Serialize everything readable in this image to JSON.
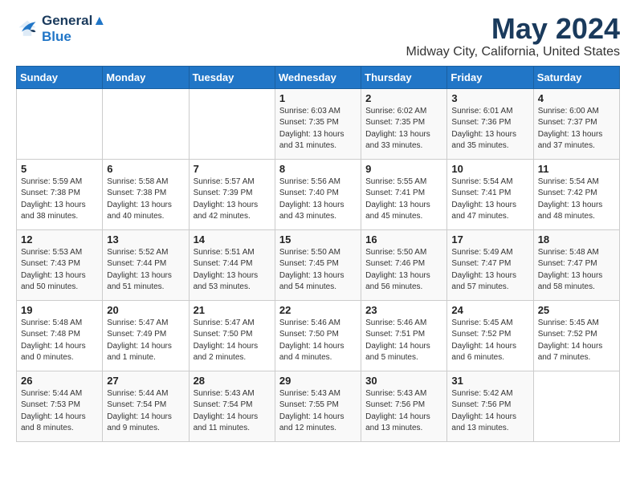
{
  "logo": {
    "line1": "General",
    "line2": "Blue"
  },
  "title": "May 2024",
  "location": "Midway City, California, United States",
  "weekdays": [
    "Sunday",
    "Monday",
    "Tuesday",
    "Wednesday",
    "Thursday",
    "Friday",
    "Saturday"
  ],
  "weeks": [
    [
      {
        "day": "",
        "sunrise": "",
        "sunset": "",
        "daylight": ""
      },
      {
        "day": "",
        "sunrise": "",
        "sunset": "",
        "daylight": ""
      },
      {
        "day": "",
        "sunrise": "",
        "sunset": "",
        "daylight": ""
      },
      {
        "day": "1",
        "sunrise": "Sunrise: 6:03 AM",
        "sunset": "Sunset: 7:35 PM",
        "daylight": "Daylight: 13 hours and 31 minutes."
      },
      {
        "day": "2",
        "sunrise": "Sunrise: 6:02 AM",
        "sunset": "Sunset: 7:35 PM",
        "daylight": "Daylight: 13 hours and 33 minutes."
      },
      {
        "day": "3",
        "sunrise": "Sunrise: 6:01 AM",
        "sunset": "Sunset: 7:36 PM",
        "daylight": "Daylight: 13 hours and 35 minutes."
      },
      {
        "day": "4",
        "sunrise": "Sunrise: 6:00 AM",
        "sunset": "Sunset: 7:37 PM",
        "daylight": "Daylight: 13 hours and 37 minutes."
      }
    ],
    [
      {
        "day": "5",
        "sunrise": "Sunrise: 5:59 AM",
        "sunset": "Sunset: 7:38 PM",
        "daylight": "Daylight: 13 hours and 38 minutes."
      },
      {
        "day": "6",
        "sunrise": "Sunrise: 5:58 AM",
        "sunset": "Sunset: 7:38 PM",
        "daylight": "Daylight: 13 hours and 40 minutes."
      },
      {
        "day": "7",
        "sunrise": "Sunrise: 5:57 AM",
        "sunset": "Sunset: 7:39 PM",
        "daylight": "Daylight: 13 hours and 42 minutes."
      },
      {
        "day": "8",
        "sunrise": "Sunrise: 5:56 AM",
        "sunset": "Sunset: 7:40 PM",
        "daylight": "Daylight: 13 hours and 43 minutes."
      },
      {
        "day": "9",
        "sunrise": "Sunrise: 5:55 AM",
        "sunset": "Sunset: 7:41 PM",
        "daylight": "Daylight: 13 hours and 45 minutes."
      },
      {
        "day": "10",
        "sunrise": "Sunrise: 5:54 AM",
        "sunset": "Sunset: 7:41 PM",
        "daylight": "Daylight: 13 hours and 47 minutes."
      },
      {
        "day": "11",
        "sunrise": "Sunrise: 5:54 AM",
        "sunset": "Sunset: 7:42 PM",
        "daylight": "Daylight: 13 hours and 48 minutes."
      }
    ],
    [
      {
        "day": "12",
        "sunrise": "Sunrise: 5:53 AM",
        "sunset": "Sunset: 7:43 PM",
        "daylight": "Daylight: 13 hours and 50 minutes."
      },
      {
        "day": "13",
        "sunrise": "Sunrise: 5:52 AM",
        "sunset": "Sunset: 7:44 PM",
        "daylight": "Daylight: 13 hours and 51 minutes."
      },
      {
        "day": "14",
        "sunrise": "Sunrise: 5:51 AM",
        "sunset": "Sunset: 7:44 PM",
        "daylight": "Daylight: 13 hours and 53 minutes."
      },
      {
        "day": "15",
        "sunrise": "Sunrise: 5:50 AM",
        "sunset": "Sunset: 7:45 PM",
        "daylight": "Daylight: 13 hours and 54 minutes."
      },
      {
        "day": "16",
        "sunrise": "Sunrise: 5:50 AM",
        "sunset": "Sunset: 7:46 PM",
        "daylight": "Daylight: 13 hours and 56 minutes."
      },
      {
        "day": "17",
        "sunrise": "Sunrise: 5:49 AM",
        "sunset": "Sunset: 7:47 PM",
        "daylight": "Daylight: 13 hours and 57 minutes."
      },
      {
        "day": "18",
        "sunrise": "Sunrise: 5:48 AM",
        "sunset": "Sunset: 7:47 PM",
        "daylight": "Daylight: 13 hours and 58 minutes."
      }
    ],
    [
      {
        "day": "19",
        "sunrise": "Sunrise: 5:48 AM",
        "sunset": "Sunset: 7:48 PM",
        "daylight": "Daylight: 14 hours and 0 minutes."
      },
      {
        "day": "20",
        "sunrise": "Sunrise: 5:47 AM",
        "sunset": "Sunset: 7:49 PM",
        "daylight": "Daylight: 14 hours and 1 minute."
      },
      {
        "day": "21",
        "sunrise": "Sunrise: 5:47 AM",
        "sunset": "Sunset: 7:50 PM",
        "daylight": "Daylight: 14 hours and 2 minutes."
      },
      {
        "day": "22",
        "sunrise": "Sunrise: 5:46 AM",
        "sunset": "Sunset: 7:50 PM",
        "daylight": "Daylight: 14 hours and 4 minutes."
      },
      {
        "day": "23",
        "sunrise": "Sunrise: 5:46 AM",
        "sunset": "Sunset: 7:51 PM",
        "daylight": "Daylight: 14 hours and 5 minutes."
      },
      {
        "day": "24",
        "sunrise": "Sunrise: 5:45 AM",
        "sunset": "Sunset: 7:52 PM",
        "daylight": "Daylight: 14 hours and 6 minutes."
      },
      {
        "day": "25",
        "sunrise": "Sunrise: 5:45 AM",
        "sunset": "Sunset: 7:52 PM",
        "daylight": "Daylight: 14 hours and 7 minutes."
      }
    ],
    [
      {
        "day": "26",
        "sunrise": "Sunrise: 5:44 AM",
        "sunset": "Sunset: 7:53 PM",
        "daylight": "Daylight: 14 hours and 8 minutes."
      },
      {
        "day": "27",
        "sunrise": "Sunrise: 5:44 AM",
        "sunset": "Sunset: 7:54 PM",
        "daylight": "Daylight: 14 hours and 9 minutes."
      },
      {
        "day": "28",
        "sunrise": "Sunrise: 5:43 AM",
        "sunset": "Sunset: 7:54 PM",
        "daylight": "Daylight: 14 hours and 11 minutes."
      },
      {
        "day": "29",
        "sunrise": "Sunrise: 5:43 AM",
        "sunset": "Sunset: 7:55 PM",
        "daylight": "Daylight: 14 hours and 12 minutes."
      },
      {
        "day": "30",
        "sunrise": "Sunrise: 5:43 AM",
        "sunset": "Sunset: 7:56 PM",
        "daylight": "Daylight: 14 hours and 13 minutes."
      },
      {
        "day": "31",
        "sunrise": "Sunrise: 5:42 AM",
        "sunset": "Sunset: 7:56 PM",
        "daylight": "Daylight: 14 hours and 13 minutes."
      },
      {
        "day": "",
        "sunrise": "",
        "sunset": "",
        "daylight": ""
      }
    ]
  ]
}
